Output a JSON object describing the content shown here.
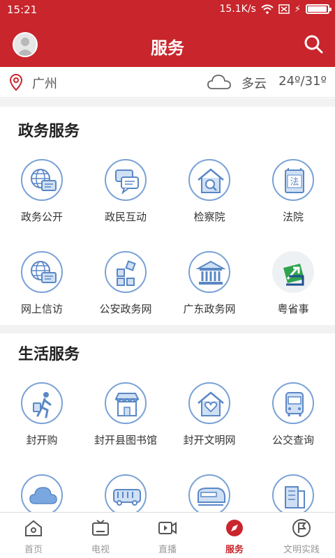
{
  "status": {
    "time": "15:21",
    "net_speed": "15.1K/s",
    "battery_level": 0.95
  },
  "header": {
    "title": "服务",
    "avatar_icon": "user-avatar",
    "search_icon": "search-icon"
  },
  "location": {
    "city": "广州",
    "weather": "多云",
    "temperature": "24º/31º"
  },
  "gov_section": {
    "title": "政务服务",
    "items": [
      {
        "label": "政务公开",
        "icon": "globe-chat-icon"
      },
      {
        "label": "政民互动",
        "icon": "chat-bubbles-icon"
      },
      {
        "label": "检察院",
        "icon": "house-search-icon"
      },
      {
        "label": "法院",
        "icon": "law-book-icon"
      },
      {
        "label": "网上信访",
        "icon": "globe-chat-icon"
      },
      {
        "label": "公安政务网",
        "icon": "grid-blocks-icon"
      },
      {
        "label": "广东政务网",
        "icon": "government-building-icon"
      },
      {
        "label": "粤省事",
        "icon": "yue-app-logo"
      }
    ]
  },
  "life_section": {
    "title": "生活服务",
    "items": [
      {
        "label": "封开购",
        "icon": "shopper-walking-icon"
      },
      {
        "label": "封开县图书馆",
        "icon": "storefront-icon"
      },
      {
        "label": "封开文明网",
        "icon": "heart-house-icon"
      },
      {
        "label": "公交查询",
        "icon": "bus-front-icon"
      },
      {
        "label": "",
        "icon": "cloud-icon"
      },
      {
        "label": "",
        "icon": "bus-side-icon"
      },
      {
        "label": "",
        "icon": "train-icon"
      },
      {
        "label": "",
        "icon": "building-icon"
      }
    ]
  },
  "tabbar": {
    "tabs": [
      {
        "label": "首页",
        "icon": "home-icon",
        "active": false
      },
      {
        "label": "电视",
        "icon": "tv-icon",
        "active": false
      },
      {
        "label": "直播",
        "icon": "live-video-icon",
        "active": false
      },
      {
        "label": "服务",
        "icon": "compass-icon",
        "active": true
      },
      {
        "label": "文明实践",
        "icon": "flag-circle-icon",
        "active": false
      }
    ]
  },
  "colors": {
    "brand_red": "#c9252c",
    "icon_blue": "#7aa2d6",
    "icon_fill": "#cfe0f5"
  }
}
